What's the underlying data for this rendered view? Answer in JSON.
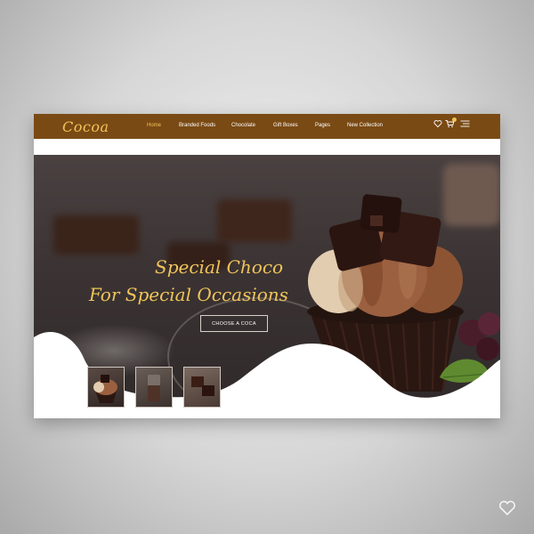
{
  "brand": {
    "logo": "Cocoa"
  },
  "nav": {
    "items": [
      {
        "label": "Home",
        "active": true
      },
      {
        "label": "Branded Foods",
        "active": false
      },
      {
        "label": "Chocolate",
        "active": false
      },
      {
        "label": "Gift Boxes",
        "active": false
      },
      {
        "label": "Pages",
        "active": false
      },
      {
        "label": "New Collection",
        "active": false
      }
    ],
    "icons": [
      "heart-icon",
      "cart-icon",
      "menu-icon"
    ]
  },
  "hero": {
    "headline_line1": "Special Choco",
    "headline_line2": "For Special Occasions",
    "cta_label": "CHOOSE A COCA",
    "thumbnails": [
      "cupcake-thumbnail",
      "drink-thumbnail",
      "chocolate-thumbnail"
    ]
  },
  "colors": {
    "nav_background": "#7a4a14",
    "accent": "#f0c45a",
    "hero_background": "#3b3333"
  }
}
